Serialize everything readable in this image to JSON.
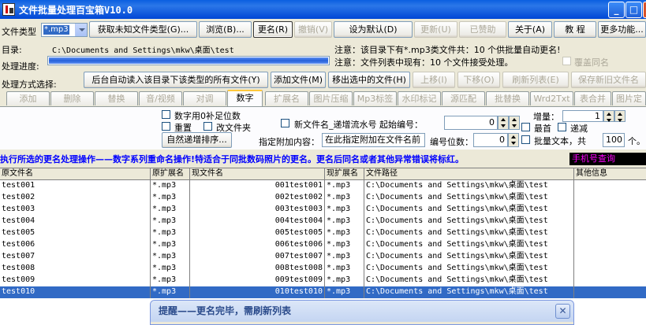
{
  "window": {
    "title": "文件批量处理百宝箱V10.0",
    "min_label": "_",
    "max_label": "□"
  },
  "row1": {
    "file_type_label": "文件类型",
    "file_type_value": "*.mp3",
    "get_unknown_button": "获取未知文件类型(G)...",
    "browse_button": "浏览(B)...",
    "rename_button": "更名(R)",
    "undo_button": "撤销(V)",
    "set_default_button": "设为默认(D)",
    "update_button": "更新(U)",
    "sponsored_button": "已赞助",
    "about_button": "关于(A)",
    "tutorial_button": "教 程",
    "more_button": "更多功能..."
  },
  "row2": {
    "dir_label": "目录:",
    "dir_path": "C:\\Documents and Settings\\mkw\\桌面\\test",
    "notice1": "注意：该目录下有*.mp3类文件共：10 个供批量自动更名!"
  },
  "row3": {
    "progress_label": "处理进度:",
    "progress_value": 1.0,
    "notice2": "注意：文件列表中现有：10 个文件接受处理。",
    "overwrite_label": "覆盖同名"
  },
  "row4": {
    "method_label": "处理方式选择:",
    "auto_read_button": "后台自动读入该目录下该类型的所有文件(Y)",
    "add_file_button": "添加文件(M)",
    "remove_selected_button": "移出选中的文件(H)",
    "move_up_button": "上移(I)",
    "move_down_button": "下移(O)",
    "refresh_button": "刷新列表(E)",
    "save_button": "保存新旧文件名"
  },
  "tabs": [
    {
      "label": "添加"
    },
    {
      "label": "删除"
    },
    {
      "label": "替换"
    },
    {
      "label": "音/视频"
    },
    {
      "label": "对调"
    },
    {
      "label": "数字"
    },
    {
      "label": "扩展名"
    },
    {
      "label": "图片压缩"
    },
    {
      "label": "Mp3标签"
    },
    {
      "label": "水印标记"
    },
    {
      "label": "源匹配"
    },
    {
      "label": "批替换"
    },
    {
      "label": "Wrd2Txt"
    },
    {
      "label": "表合并"
    },
    {
      "label": "图片定"
    }
  ],
  "digit_panel": {
    "pad_zero_label": "数字用0补足位数",
    "reset_label": "重置",
    "rename_folder_label": "改文件夹",
    "natural_sort_button": "自然递增排序...",
    "new_name_label": "新文件名_递增流水号  起始编号：",
    "start_value": "0",
    "increment_label": "增量：",
    "increment_value": "1",
    "first_label": "最首",
    "decrement_label": "递减",
    "append_label": "指定附加内容：",
    "append_value": "在此指定附加在文件名前",
    "digits_label": "编号位数：",
    "digits_value": "0",
    "batch_text_label": "批量文本，共",
    "batch_count": "100",
    "batch_unit": "个。"
  },
  "banner": {
    "text": "执行所选的更名处理操作——数字系列重命名操作!特适合于同批数码照片的更名。更名后同名或者其他异常错误将标红。",
    "phone_query": "手机号查询"
  },
  "table": {
    "headers": [
      "原文件名",
      "原扩展名",
      "现文件名",
      "现扩展名",
      "文件路径",
      "其他信息"
    ],
    "rows": [
      [
        "test001",
        "*.mp3",
        "001test001",
        "*.mp3",
        "C:\\Documents and Settings\\mkw\\桌面\\test",
        ""
      ],
      [
        "test002",
        "*.mp3",
        "002test002",
        "*.mp3",
        "C:\\Documents and Settings\\mkw\\桌面\\test",
        ""
      ],
      [
        "test003",
        "*.mp3",
        "003test003",
        "*.mp3",
        "C:\\Documents and Settings\\mkw\\桌面\\test",
        ""
      ],
      [
        "test004",
        "*.mp3",
        "004test004",
        "*.mp3",
        "C:\\Documents and Settings\\mkw\\桌面\\test",
        ""
      ],
      [
        "test005",
        "*.mp3",
        "005test005",
        "*.mp3",
        "C:\\Documents and Settings\\mkw\\桌面\\test",
        ""
      ],
      [
        "test006",
        "*.mp3",
        "006test006",
        "*.mp3",
        "C:\\Documents and Settings\\mkw\\桌面\\test",
        ""
      ],
      [
        "test007",
        "*.mp3",
        "007test007",
        "*.mp3",
        "C:\\Documents and Settings\\mkw\\桌面\\test",
        ""
      ],
      [
        "test008",
        "*.mp3",
        "008test008",
        "*.mp3",
        "C:\\Documents and Settings\\mkw\\桌面\\test",
        ""
      ],
      [
        "test009",
        "*.mp3",
        "009test009",
        "*.mp3",
        "C:\\Documents and Settings\\mkw\\桌面\\test",
        ""
      ],
      [
        "test010",
        "*.mp3",
        "010test010",
        "*.mp3",
        "C:\\Documents and Settings\\mkw\\桌面\\test",
        ""
      ]
    ],
    "selected_row": 9
  },
  "popup": {
    "title": "提醒——更名完毕，需刷新列表",
    "close_label": "✕"
  }
}
